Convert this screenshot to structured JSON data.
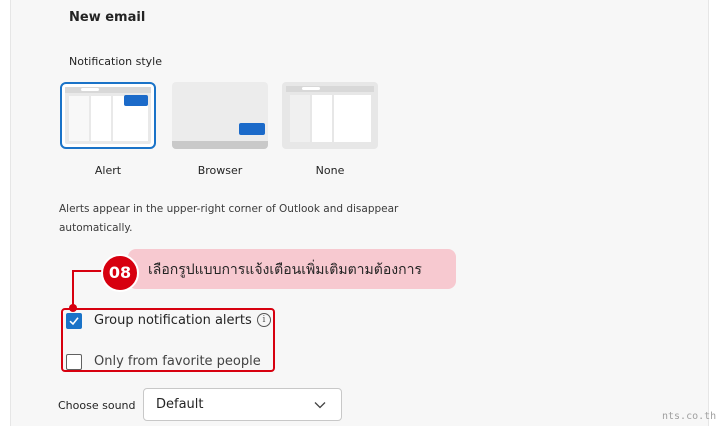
{
  "section": {
    "title": "New email"
  },
  "notification_style": {
    "label": "Notification style",
    "options": [
      {
        "name": "Alert",
        "selected": true
      },
      {
        "name": "Browser",
        "selected": false
      },
      {
        "name": "None",
        "selected": false
      }
    ],
    "description": "Alerts appear in the upper-right corner of Outlook and disappear automatically."
  },
  "annotation": {
    "step": "08",
    "text": "เลือกรูปแบบการแจ้งเตือนเพิ่มเติมตามต้องการ"
  },
  "group_alerts": {
    "label": "Group notification alerts",
    "checked": true,
    "info_icon": "info-icon"
  },
  "favorites": {
    "label": "Only from favorite people",
    "checked": false
  },
  "sound": {
    "label": "Choose sound",
    "value": "Default"
  },
  "watermark": "nts.co.th",
  "colors": {
    "accent": "#1a73c8",
    "annotation_red": "#d7000f",
    "callout_pink": "#f7c9d0"
  }
}
